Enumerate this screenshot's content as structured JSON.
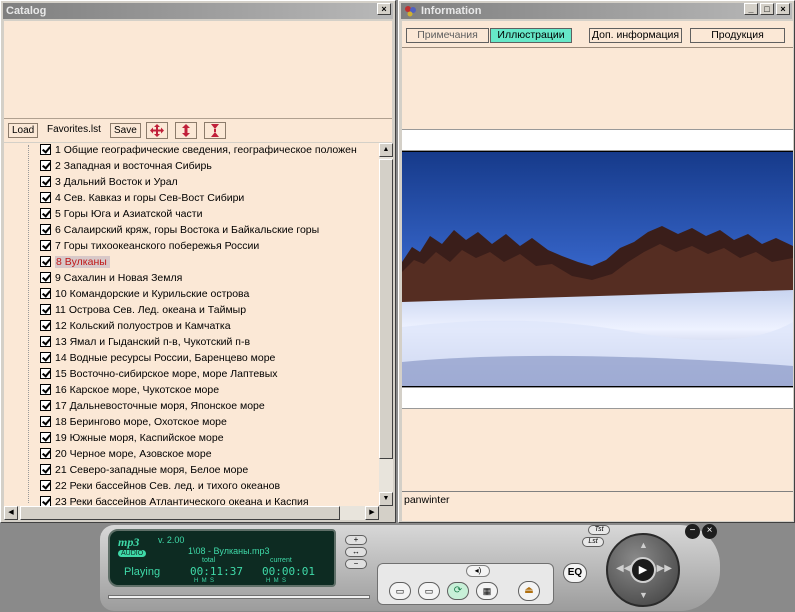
{
  "catalog": {
    "title": "Catalog",
    "close_glyph": "×",
    "toolbar": {
      "load_label": "Load",
      "file_name": "Favorites.lst",
      "save_label": "Save",
      "icons": [
        "move-all-icon",
        "move-vertical-icon",
        "collapse-icon"
      ]
    },
    "items": [
      {
        "label": "1 Общие географические сведения, географическое положен",
        "checked": true
      },
      {
        "label": "2 Западная и восточная Сибирь",
        "checked": true
      },
      {
        "label": "3 Дальний Восток и Урал",
        "checked": true
      },
      {
        "label": "4 Сев. Кавказ и горы Сев-Вост Сибири",
        "checked": true
      },
      {
        "label": "5 Горы Юга и Азиатской части",
        "checked": true
      },
      {
        "label": "6 Салаирский кряж, горы Востока и Байкальские горы",
        "checked": true
      },
      {
        "label": "7 Горы тихоокеанского побережья России",
        "checked": true
      },
      {
        "label": "8 Вулканы",
        "checked": true,
        "selected": true
      },
      {
        "label": "9 Сахалин и Новая Земля",
        "checked": true
      },
      {
        "label": "10 Командорские и Курильские острова",
        "checked": true
      },
      {
        "label": "11 Острова Сев. Лед. океана и Таймыр",
        "checked": true
      },
      {
        "label": "12 Кольский полуостров и Камчатка",
        "checked": true
      },
      {
        "label": "13 Ямал и Гыданский п-в, Чукотский п-в",
        "checked": true
      },
      {
        "label": "14 Водные ресурсы России, Баренцево море",
        "checked": true
      },
      {
        "label": "15 Восточно-сибирское море, море Лаптевых",
        "checked": true
      },
      {
        "label": "16 Карское море, Чукотское море",
        "checked": true
      },
      {
        "label": "17 Дальневосточные моря, Японское море",
        "checked": true
      },
      {
        "label": "18 Берингово море, Охотское море",
        "checked": true
      },
      {
        "label": "19 Южные моря, Каспийское море",
        "checked": true
      },
      {
        "label": "20 Черное море, Азовское море",
        "checked": true
      },
      {
        "label": "21 Северо-западные моря, Белое море",
        "checked": true
      },
      {
        "label": "22 Реки бассейнов Сев. лед. и тихого океанов",
        "checked": true
      },
      {
        "label": "23 Реки бассейнов Атлантического океана и Каспия",
        "checked": true
      }
    ]
  },
  "info": {
    "title": "Information",
    "tabs": [
      {
        "label": "Примечания",
        "active": false
      },
      {
        "label": "Иллюстрации",
        "active": true
      },
      {
        "label": "Доп. информация",
        "active": false
      },
      {
        "label": "Продукция",
        "active": false
      }
    ],
    "caption": "panwinter"
  },
  "player": {
    "logo": "mp3",
    "sublogo": "AUDIO",
    "version": "v. 2.00",
    "track": "1\\08 - Вулканы.mp3",
    "status": "Playing",
    "total_label": "total",
    "total_time": "00:11:37",
    "current_label": "current",
    "current_time": "00:00:01",
    "hms_total": "H  M  S",
    "hms_current": "H  M  S",
    "eq_label": "EQ",
    "tst_label": "Tst",
    "lst_label": "Lst"
  },
  "colors": {
    "panel_bg": "#fbe8d6",
    "active_tab": "#66e8c8",
    "selected_text": "#c01818",
    "lcd_text": "#3fd9a8"
  }
}
